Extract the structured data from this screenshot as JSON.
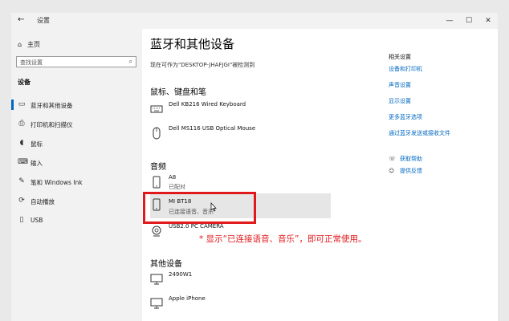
{
  "window": {
    "back_icon": "back-arrow-icon",
    "title": "设置",
    "minimize": "—",
    "maximize": "☐",
    "close": "✕"
  },
  "sidebar": {
    "home": "主页",
    "search_placeholder": "查找设置",
    "section": "设备",
    "items": [
      {
        "label": "蓝牙和其他设备",
        "icon": "bluetooth-devices-icon",
        "active": true
      },
      {
        "label": "打印机和扫描仪",
        "icon": "printer-icon"
      },
      {
        "label": "鼠标",
        "icon": "mouse-icon"
      },
      {
        "label": "输入",
        "icon": "keyboard-icon"
      },
      {
        "label": "笔和 Windows Ink",
        "icon": "pen-icon"
      },
      {
        "label": "自动播放",
        "icon": "autoplay-icon"
      },
      {
        "label": "USB",
        "icon": "usb-icon"
      }
    ]
  },
  "main": {
    "title": "蓝牙和其他设备",
    "discoverable": "现在可作为\"DESKTOP-JHAFJGI\"被检测到",
    "sections": {
      "input": "鼠标、键盘和笔",
      "audio": "音频",
      "other": "其他设备"
    },
    "devices": {
      "keyboard": {
        "name": "Dell KB216 Wired Keyboard",
        "status": ""
      },
      "mouse": {
        "name": "Dell MS116 USB Optical Mouse",
        "status": ""
      },
      "a8": {
        "name": "A8",
        "status": "已配对"
      },
      "mibt": {
        "name": "MI BT18",
        "status": "已连接语音、音乐"
      },
      "camera": {
        "name": "USB2.0 PC CAMERA",
        "status": ""
      },
      "monitor": {
        "name": "2490W1",
        "status": ""
      },
      "iphone": {
        "name": "Apple iPhone",
        "status": ""
      }
    },
    "annotation": "* 显示“已连接语音、音乐”，即可正常使用。"
  },
  "related": {
    "heading": "相关设置",
    "links": [
      "设备和打印机",
      "声音设置",
      "显示设置",
      "更多蓝牙选项",
      "通过蓝牙发送或接收文件"
    ],
    "help": "获取帮助",
    "feedback": "提供反馈"
  },
  "colors": {
    "accent": "#0067c0",
    "annotation": "#e0191c"
  }
}
